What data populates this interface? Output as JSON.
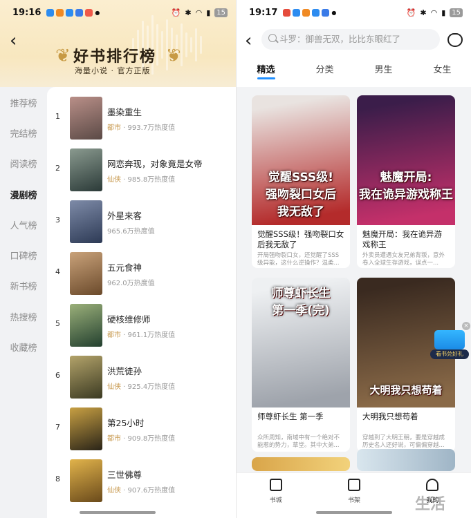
{
  "left_screen": {
    "status": {
      "time": "19:16",
      "battery": "15"
    },
    "header": {
      "title": "好书排行榜",
      "subtitle": "海量小说 · 官方正版"
    },
    "categories": [
      "推荐榜",
      "完结榜",
      "阅读榜",
      "漫剧榜",
      "人气榜",
      "口碑榜",
      "新书榜",
      "热搜榜",
      "收藏榜"
    ],
    "active_category": "漫剧榜",
    "ranking": [
      {
        "rank": "1",
        "title": "墨染重生",
        "tag": "都市",
        "heat": "993.7万热度值",
        "colors": [
          "#5b4a46",
          "#b98f88"
        ]
      },
      {
        "rank": "2",
        "title": "网恋奔现，对象竟是女帝",
        "tag": "仙侠",
        "heat": "985.8万热度值",
        "colors": [
          "#2b3a38",
          "#8a9a8f"
        ]
      },
      {
        "rank": "3",
        "title": "外星来客",
        "tag": "",
        "heat": "965.6万热度值",
        "colors": [
          "#2d3a55",
          "#7e8ba8"
        ]
      },
      {
        "rank": "4",
        "title": "五元食神",
        "tag": "",
        "heat": "962.0万热度值",
        "colors": [
          "#6b4a2b",
          "#c9a27a"
        ]
      },
      {
        "rank": "5",
        "title": "硬核维修师",
        "tag": "都市",
        "heat": "961.1万热度值",
        "colors": [
          "#23402f",
          "#9bb07a"
        ]
      },
      {
        "rank": "6",
        "title": "洪荒徒孙",
        "tag": "仙侠",
        "heat": "925.4万热度值",
        "colors": [
          "#3b3a22",
          "#b3a36a"
        ]
      },
      {
        "rank": "7",
        "title": "第25小时",
        "tag": "都市",
        "heat": "909.8万热度值",
        "colors": [
          "#2a2418",
          "#c8a043"
        ]
      },
      {
        "rank": "8",
        "title": "三世佛尊",
        "tag": "仙侠",
        "heat": "907.6万热度值",
        "colors": [
          "#6a4a1b",
          "#e1b34b"
        ]
      }
    ]
  },
  "right_screen": {
    "status": {
      "time": "19:17",
      "battery": "15"
    },
    "search": {
      "placeholder": "斗罗：御兽无双，比比东眼红了"
    },
    "tabs": [
      "精选",
      "分类",
      "男生",
      "女生"
    ],
    "active_tab": "精选",
    "books": [
      {
        "cover_text": "觉醒SSS级!\n强吻裂口女后\n我无敌了",
        "title": "觉醒SSS级！强吻裂口女后我无敌了",
        "desc": "开局强吻裂口女，还觉醒了SSS级异能，这什么逆操作？温柔...",
        "genre": "",
        "colors": [
          "#e9e3e0",
          "#b42b2b"
        ]
      },
      {
        "cover_text": "魅魔开局:\n我在诡异游戏称王",
        "title": "魅魔开局：我在诡异游戏称王",
        "desc": "外卖员遭遇女友兄弟背叛，意外卷入全球生存游戏，误点一...",
        "genre": "",
        "colors": [
          "#3b1d4a",
          "#c4306a"
        ]
      },
      {
        "cover_text": "师尊虾长生\n第一季(完)",
        "title": "师尊虾长生 第一季",
        "desc": "众所周知，南域中有一个绝对不能惹的势力，草堂。其中大弟...",
        "genre": "仙侠",
        "colors": [
          "#eef0f2",
          "#9ea3ab"
        ]
      },
      {
        "cover_text": "大明我只想苟着",
        "title": "大明我只想苟着",
        "desc": "穿越到了大明王朝，要是穿越成历史名人还好说，可偏偏穿越...",
        "genre": "",
        "colors": [
          "#3a2a20",
          "#8a6a48"
        ]
      }
    ],
    "gift_label": "看书兑好礼",
    "bottom_nav": [
      "书城",
      "书架",
      "我的"
    ]
  },
  "watermark": "生活"
}
